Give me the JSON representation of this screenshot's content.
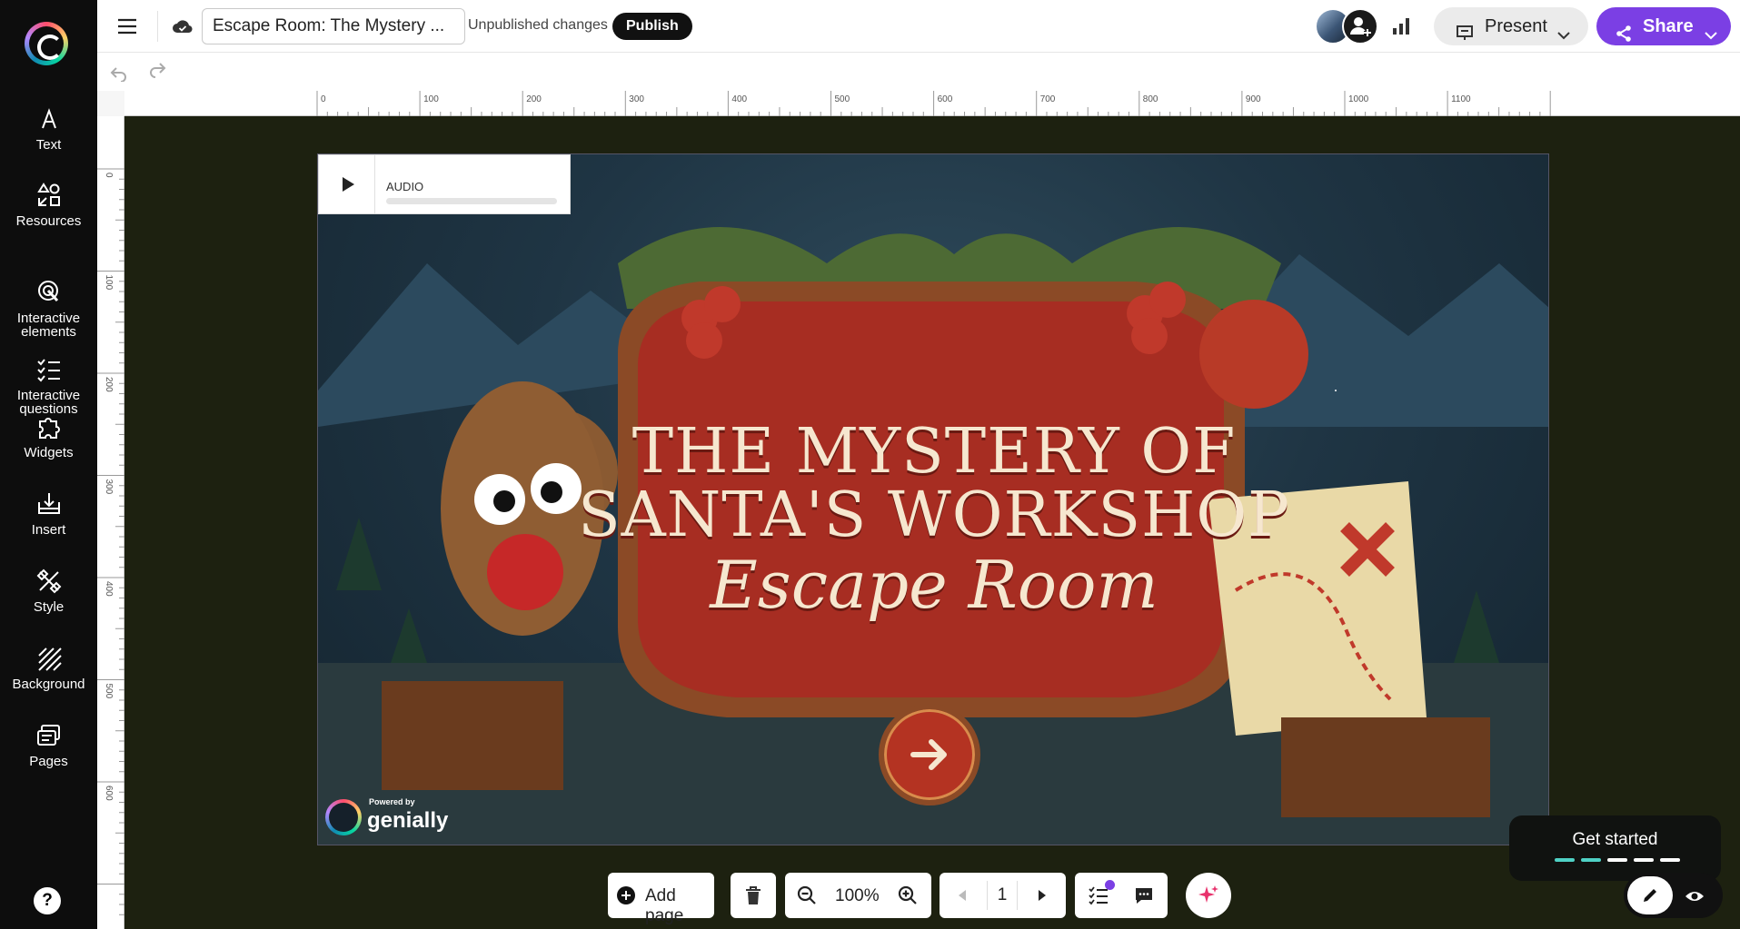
{
  "sidebar": {
    "items": [
      {
        "label": "Text",
        "icon": "text-icon"
      },
      {
        "label": "Resources",
        "icon": "shapes-icon"
      },
      {
        "label": "Interactive\nelements",
        "icon": "touch-icon"
      },
      {
        "label": "Interactive\nquestions",
        "icon": "checklist-icon"
      },
      {
        "label": "Widgets",
        "icon": "puzzle-icon"
      },
      {
        "label": "Insert",
        "icon": "insert-icon"
      },
      {
        "label": "Style",
        "icon": "style-icon"
      },
      {
        "label": "Background",
        "icon": "background-icon"
      },
      {
        "label": "Pages",
        "icon": "pages-icon"
      }
    ],
    "help_label": "?"
  },
  "header": {
    "title_value": "Escape Room: The Mystery ...",
    "status": "Unpublished changes",
    "publish_label": "Publish",
    "present_label": "Present",
    "share_label": "Share"
  },
  "ruler": {
    "horizontal": [
      "0",
      "100",
      "200",
      "300",
      "400",
      "500",
      "600",
      "700",
      "800",
      "900",
      "1000",
      "1100"
    ],
    "vertical": [
      "0",
      "100",
      "200",
      "300",
      "400",
      "500",
      "600"
    ]
  },
  "slide": {
    "audio_label": "AUDIO",
    "title_line1": "THE MYSTERY OF",
    "title_line2": "SANTA'S WORKSHOP",
    "title_line3": "Escape Room",
    "powered_by": "Powered by",
    "powered_brand": "genially"
  },
  "toolbar": {
    "add_page_label": "Add page",
    "zoom_value": "100%",
    "page_number": "1"
  },
  "onboarding": {
    "label": "Get started",
    "progress_completed": 2,
    "progress_total": 5
  },
  "colors": {
    "accent": "#7b3fe4",
    "sidebar_bg": "#0d0d0d",
    "canvas_bg": "#1d2110"
  }
}
